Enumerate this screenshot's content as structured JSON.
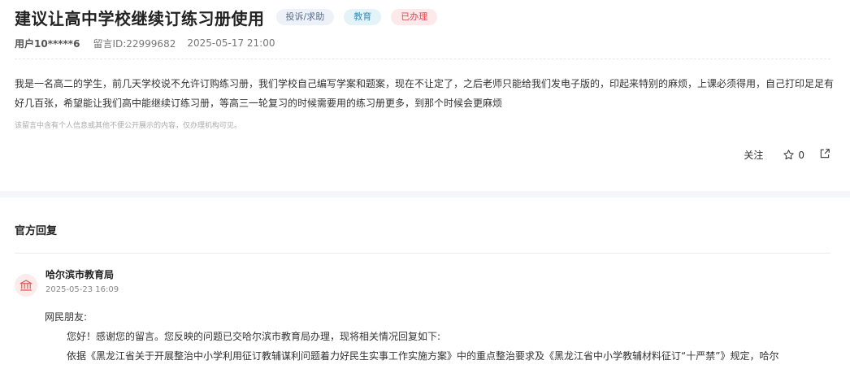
{
  "post": {
    "title": "建议让高中学校继续订练习册使用",
    "tags": {
      "type": "投诉/求助",
      "category": "教育",
      "status": "已办理"
    },
    "user": "用户10*****6",
    "message_id": "留言ID:22999682",
    "datetime": "2025-05-17 21:00",
    "body": "我是一名高二的学生，前几天学校说不允许订购练习册，我们学校自己编写学案和题案，现在不让定了，之后老师只能给我们发电子版的，印起来特别的麻烦，上课必须得用，自己打印足足有好几百张，希望能让我们高中能继续订练习册，等高三一轮复习的时候需要用的练习册更多，到那个时候会更麻烦",
    "privacy_note": "该留言中含有个人信息或其他不便公开展示的内容，仅办理机构可见。",
    "follow_label": "关注",
    "star_count": "0"
  },
  "reply_section": {
    "title": "官方回复",
    "org_name": "哈尔滨市教育局",
    "org_date": "2025-05-23 16:09",
    "greeting": "网民朋友:",
    "para1": "您好！感谢您的留言。您反映的问题已交哈尔滨市教育局办理，现将相关情况回复如下:",
    "para2": "依据《黑龙江省关于开展整治中小学利用征订教辅谋利问题着力好民生实事工作实施方案》中的重点整治要求及《黑龙江省中小学教辅材料征订“十严禁”》规定，哈尔"
  },
  "colors": {
    "status_red": "#e2454f",
    "org_icon": "#e05a5a"
  },
  "icons": [
    "star-icon",
    "share-icon",
    "government-building-icon"
  ]
}
